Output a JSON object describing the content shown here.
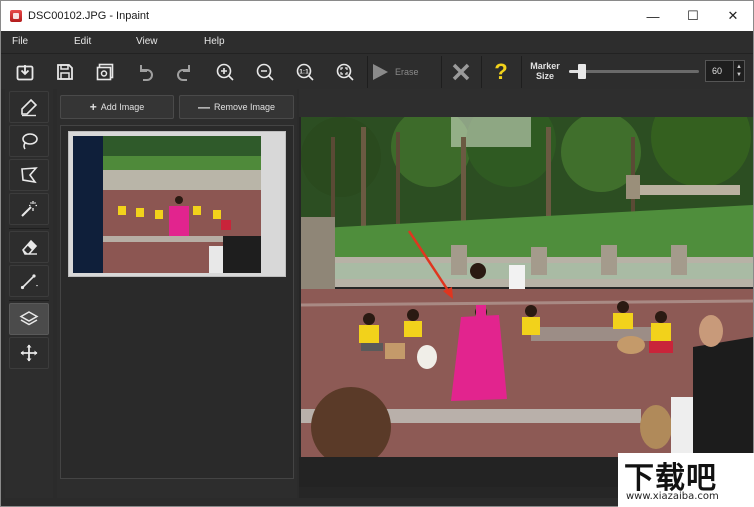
{
  "window": {
    "title": "DSC00102.JPG - Inpaint",
    "controls": {
      "minimize": "—",
      "maximize": "☐",
      "close": "✕"
    }
  },
  "menu": {
    "file": "File",
    "edit": "Edit",
    "view": "View",
    "help": "Help"
  },
  "toolbar": {
    "erase_label": "Erase",
    "marker_label": "Marker Size",
    "marker_size_value": "60",
    "marker_size_fraction": 0.1,
    "help_symbol": "?"
  },
  "panel": {
    "add_label": "Add Image",
    "add_symbol": "+",
    "remove_label": "Remove Image",
    "remove_symbol": "—"
  },
  "watermark": {
    "big": "下载吧",
    "small": "www.xiazaiba.com"
  },
  "colors": {
    "accent_yellow": "#f2d21b",
    "red_arrow": "#e0351f",
    "dancer_pink": "#e2248e",
    "dark_bg": "#2d2d2d"
  }
}
